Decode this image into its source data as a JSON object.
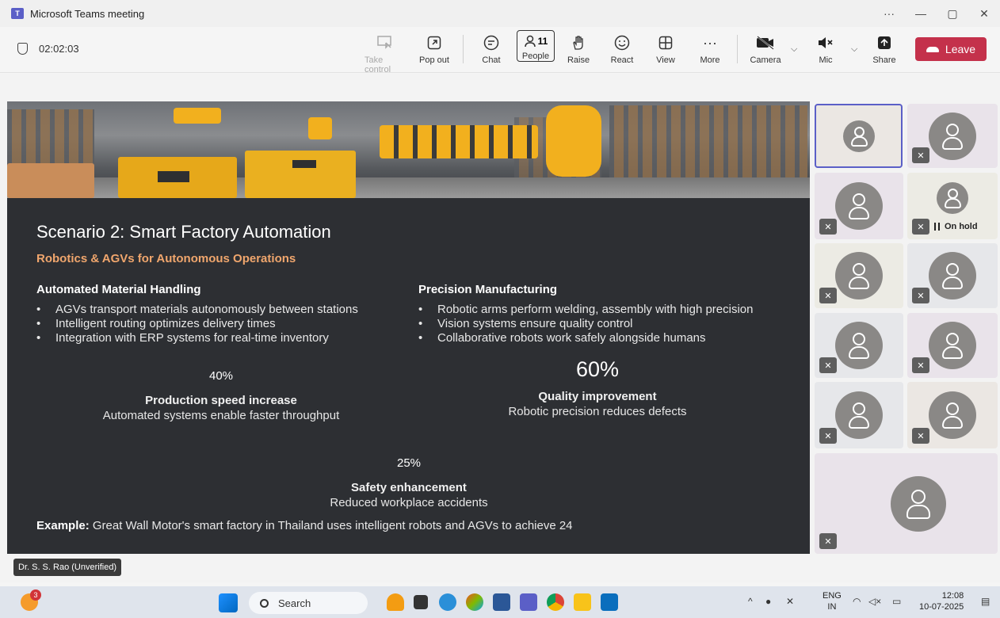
{
  "window": {
    "title": "Microsoft Teams meeting",
    "controls": [
      "···",
      "—",
      "▢",
      "✕"
    ]
  },
  "toolbar": {
    "timer": "02:02:03",
    "take_control": "Take control",
    "pop_out": "Pop out",
    "chat": "Chat",
    "people": "People",
    "people_count": "11",
    "raise": "Raise",
    "react": "React",
    "view": "View",
    "more": "More",
    "camera": "Camera",
    "mic": "Mic",
    "share": "Share",
    "leave": "Leave"
  },
  "slide": {
    "title": "Scenario 2: Smart Factory Automation",
    "subtitle": "Robotics & AGVs for Autonomous Operations",
    "col1": {
      "heading": "Automated Material Handling",
      "bullets": [
        "AGVs transport materials autonomously between stations",
        "Intelligent routing optimizes delivery times",
        "Integration with ERP systems for real-time inventory"
      ]
    },
    "col2": {
      "heading": "Precision Manufacturing",
      "bullets": [
        "Robotic arms perform welding, assembly with high precision",
        "Vision systems ensure quality control",
        "Collaborative robots work safely alongside humans"
      ]
    },
    "stats": [
      {
        "value": "40%",
        "heading": "Production speed increase",
        "desc": "Automated systems enable faster throughput"
      },
      {
        "value": "60%",
        "heading": "Quality improvement",
        "desc": "Robotic precision reduces defects"
      },
      {
        "value": "25%",
        "heading": "Safety enhancement",
        "desc": "Reduced workplace accidents"
      }
    ],
    "example_label": "Example:",
    "example_text": " Great Wall Motor's smart factory in Thailand uses intelligent robots and AGVs to achieve 24"
  },
  "participants": {
    "on_hold": "On hold"
  },
  "presenter": "Dr. S. S. Rao (Unverified)",
  "taskbar": {
    "search": "Search",
    "notification_count": "3",
    "language": "ENG",
    "region": "IN",
    "time": "12:08",
    "date": "10-07-2025"
  },
  "colors": {
    "leave_red": "#c4314b",
    "accent": "#5b5fc7",
    "slide_bg": "#2d2f33",
    "subtitle_orange": "#f0a66d"
  }
}
